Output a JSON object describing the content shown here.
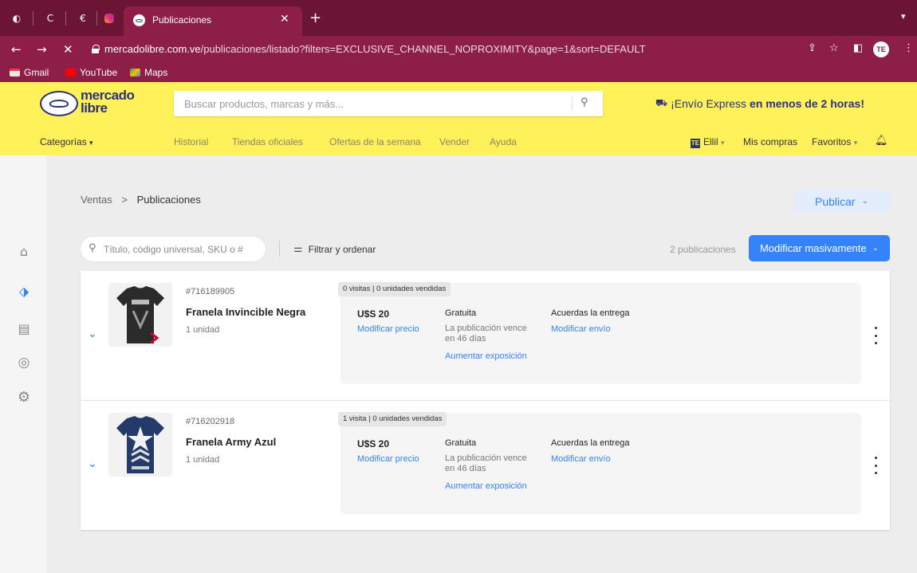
{
  "browser": {
    "tab_title": "Publicaciones",
    "url_host": "mercadolibre.com.ve",
    "url_path": "/publicaciones/listado?filters=EXCLUSIVE_CHANNEL_NOPROXIMITY&page=1&sort=DEFAULT",
    "profile_initials": "TE",
    "bookmarks": [
      {
        "label": "Gmail",
        "icon": "gmail-icon"
      },
      {
        "label": "YouTube",
        "icon": "youtube-icon"
      },
      {
        "label": "Maps",
        "icon": "maps-icon"
      }
    ]
  },
  "header": {
    "logo_text": "mercado libre",
    "search_placeholder": "Buscar productos, marcas y más...",
    "promo_prefix": "¡Envío Express",
    "promo_bold": "en menos de 2 horas!",
    "nav": {
      "categorias": "Categorías",
      "historial": "Historial",
      "tiendas": "Tiendas oficiales",
      "ofertas": "Ofertas de la semana",
      "vender": "Vender",
      "ayuda": "Ayuda",
      "user_badge": "TE",
      "user": "Ellil",
      "mis_compras": "Mis compras",
      "favoritos": "Favoritos"
    }
  },
  "page": {
    "breadcrumb_root": "Ventas",
    "breadcrumb_current": "Publicaciones",
    "publish_button": "Publicar",
    "search_placeholder": "Título, código universal, SKU o #",
    "filter_label": "Filtrar y ordenar",
    "count_label": "2 publicaciones",
    "bulk_button": "Modificar masivamente"
  },
  "listings": [
    {
      "code": "#716189905",
      "name": "Franela Invincible Negra",
      "units": "1 unidad",
      "stats": "0 visitas | 0 unidades vendidas",
      "price": "U$S 20",
      "edit_price": "Modificar precio",
      "plan": "Gratuita",
      "expires": "La publicación vence en 46 días",
      "boost": "Aumentar exposición",
      "shipping": "Acuerdas la entrega",
      "edit_shipping": "Modificar envío"
    },
    {
      "code": "#716202918",
      "name": "Franela Army Azul",
      "units": "1 unidad",
      "stats": "1 visita | 0 unidades vendidas",
      "price": "U$S 20",
      "edit_price": "Modificar precio",
      "plan": "Gratuita",
      "expires": "La publicación vence en 46 días",
      "boost": "Aumentar exposición",
      "shipping": "Acuerdas la entrega",
      "edit_shipping": "Modificar envío"
    }
  ],
  "colors": {
    "chrome": "#8d1e48",
    "ml_yellow": "#fff159",
    "ml_blue": "#3483fa",
    "logo_navy": "#2d3277"
  }
}
